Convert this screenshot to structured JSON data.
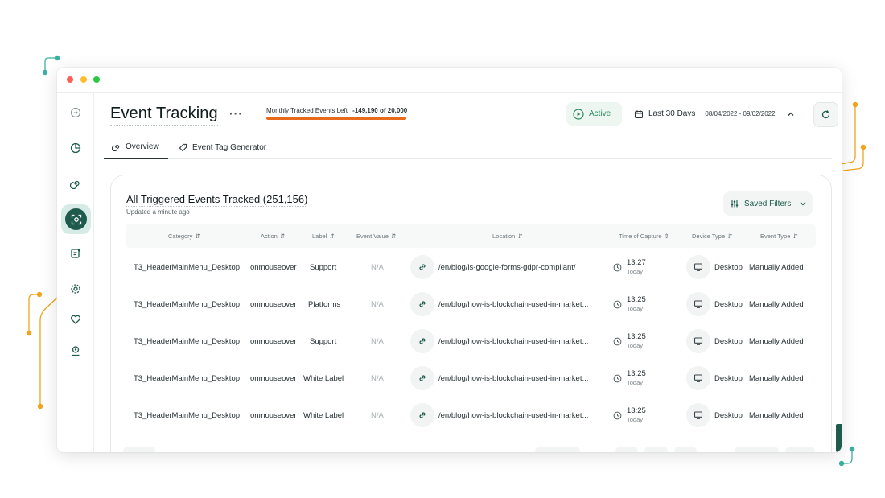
{
  "app": {
    "page_title": "Event Tracking",
    "more_label": "···",
    "quota": {
      "label": "Monthly Tracked Events Left",
      "value": "-149,190 of 20,000",
      "accent_color": "#e86b1c"
    },
    "status": {
      "label": "Active",
      "icon": "play-circle-icon",
      "color": "#2b8a5e"
    },
    "date_range": {
      "label": "Last 30 Days",
      "dates": "08/04/2022 - 09/02/2022",
      "icon": "calendar-icon"
    },
    "brand_color": "#1f5b4d"
  },
  "sidebar": {
    "items": [
      {
        "name": "sidebar-item-home",
        "icon": "circle-arrow-icon",
        "active": false
      },
      {
        "name": "sidebar-item-analytics",
        "icon": "pie-chart-icon",
        "active": false
      },
      {
        "name": "sidebar-item-tracking",
        "icon": "spiral-icon",
        "active": false
      },
      {
        "name": "sidebar-item-event-tracking",
        "icon": "scan-target-icon",
        "active": true
      },
      {
        "name": "sidebar-item-reports",
        "icon": "report-icon",
        "active": false
      },
      {
        "name": "sidebar-item-settings",
        "icon": "gear-icon",
        "active": false
      },
      {
        "name": "sidebar-item-favorites",
        "icon": "heart-icon",
        "active": false
      },
      {
        "name": "sidebar-item-account",
        "icon": "user-badge-icon",
        "active": false
      }
    ]
  },
  "tabs": [
    {
      "label": "Overview",
      "active": true,
      "icon": "spiral-icon"
    },
    {
      "label": "Event Tag Generator",
      "active": false,
      "icon": "tag-icon"
    }
  ],
  "card": {
    "title": "All Triggered Events Tracked (251,156)",
    "subtitle": "Updated a minute ago",
    "saved_filters_label": "Saved Filters"
  },
  "table": {
    "headers": [
      "Category",
      "Action",
      "Label",
      "Event Value",
      "Location",
      "Time of Capture",
      "Device Type",
      "Event Type"
    ],
    "rows": [
      {
        "category": "T3_HeaderMainMenu_Desktop",
        "action": "onmouseover",
        "label": "Support",
        "value": "N/A",
        "location": "/en/blog/is-google-forms-gdpr-compliant/",
        "time": "13:27",
        "day": "Today",
        "device": "Desktop",
        "event_type": "Manually Added"
      },
      {
        "category": "T3_HeaderMainMenu_Desktop",
        "action": "onmouseover",
        "label": "Platforms",
        "value": "N/A",
        "location": "/en/blog/how-is-blockchain-used-in-market...",
        "time": "13:25",
        "day": "Today",
        "device": "Desktop",
        "event_type": "Manually Added"
      },
      {
        "category": "T3_HeaderMainMenu_Desktop",
        "action": "onmouseover",
        "label": "Support",
        "value": "N/A",
        "location": "/en/blog/how-is-blockchain-used-in-market...",
        "time": "13:25",
        "day": "Today",
        "device": "Desktop",
        "event_type": "Manually Added"
      },
      {
        "category": "T3_HeaderMainMenu_Desktop",
        "action": "onmouseover",
        "label": "White Label",
        "value": "N/A",
        "location": "/en/blog/how-is-blockchain-used-in-market...",
        "time": "13:25",
        "day": "Today",
        "device": "Desktop",
        "event_type": "Manually Added"
      },
      {
        "category": "T3_HeaderMainMenu_Desktop",
        "action": "onmouseover",
        "label": "White Label",
        "value": "N/A",
        "location": "/en/blog/how-is-blockchain-used-in-market...",
        "time": "13:25",
        "day": "Today",
        "device": "Desktop",
        "event_type": "Manually Added"
      }
    ]
  }
}
